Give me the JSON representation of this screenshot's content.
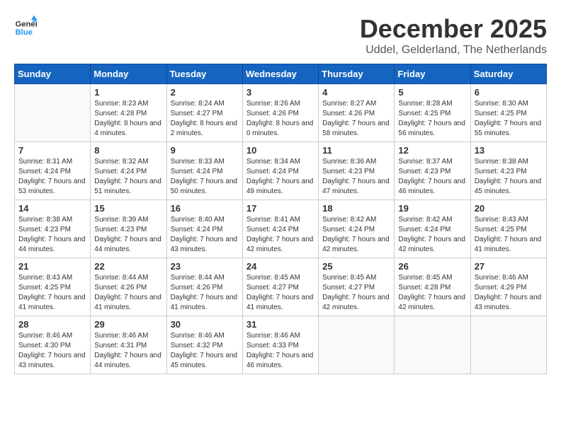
{
  "header": {
    "logo_line1": "General",
    "logo_line2": "Blue",
    "month": "December 2025",
    "location": "Uddel, Gelderland, The Netherlands"
  },
  "weekdays": [
    "Sunday",
    "Monday",
    "Tuesday",
    "Wednesday",
    "Thursday",
    "Friday",
    "Saturday"
  ],
  "weeks": [
    [
      {
        "day": "",
        "empty": true
      },
      {
        "day": "1",
        "sunrise": "8:23 AM",
        "sunset": "4:28 PM",
        "daylight": "8 hours and 4 minutes."
      },
      {
        "day": "2",
        "sunrise": "8:24 AM",
        "sunset": "4:27 PM",
        "daylight": "8 hours and 2 minutes."
      },
      {
        "day": "3",
        "sunrise": "8:26 AM",
        "sunset": "4:26 PM",
        "daylight": "8 hours and 0 minutes."
      },
      {
        "day": "4",
        "sunrise": "8:27 AM",
        "sunset": "4:26 PM",
        "daylight": "7 hours and 58 minutes."
      },
      {
        "day": "5",
        "sunrise": "8:28 AM",
        "sunset": "4:25 PM",
        "daylight": "7 hours and 56 minutes."
      },
      {
        "day": "6",
        "sunrise": "8:30 AM",
        "sunset": "4:25 PM",
        "daylight": "7 hours and 55 minutes."
      }
    ],
    [
      {
        "day": "7",
        "sunrise": "8:31 AM",
        "sunset": "4:24 PM",
        "daylight": "7 hours and 53 minutes."
      },
      {
        "day": "8",
        "sunrise": "8:32 AM",
        "sunset": "4:24 PM",
        "daylight": "7 hours and 51 minutes."
      },
      {
        "day": "9",
        "sunrise": "8:33 AM",
        "sunset": "4:24 PM",
        "daylight": "7 hours and 50 minutes."
      },
      {
        "day": "10",
        "sunrise": "8:34 AM",
        "sunset": "4:24 PM",
        "daylight": "7 hours and 49 minutes."
      },
      {
        "day": "11",
        "sunrise": "8:36 AM",
        "sunset": "4:23 PM",
        "daylight": "7 hours and 47 minutes."
      },
      {
        "day": "12",
        "sunrise": "8:37 AM",
        "sunset": "4:23 PM",
        "daylight": "7 hours and 46 minutes."
      },
      {
        "day": "13",
        "sunrise": "8:38 AM",
        "sunset": "4:23 PM",
        "daylight": "7 hours and 45 minutes."
      }
    ],
    [
      {
        "day": "14",
        "sunrise": "8:38 AM",
        "sunset": "4:23 PM",
        "daylight": "7 hours and 44 minutes."
      },
      {
        "day": "15",
        "sunrise": "8:39 AM",
        "sunset": "4:23 PM",
        "daylight": "7 hours and 44 minutes."
      },
      {
        "day": "16",
        "sunrise": "8:40 AM",
        "sunset": "4:24 PM",
        "daylight": "7 hours and 43 minutes."
      },
      {
        "day": "17",
        "sunrise": "8:41 AM",
        "sunset": "4:24 PM",
        "daylight": "7 hours and 42 minutes."
      },
      {
        "day": "18",
        "sunrise": "8:42 AM",
        "sunset": "4:24 PM",
        "daylight": "7 hours and 42 minutes."
      },
      {
        "day": "19",
        "sunrise": "8:42 AM",
        "sunset": "4:24 PM",
        "daylight": "7 hours and 42 minutes."
      },
      {
        "day": "20",
        "sunrise": "8:43 AM",
        "sunset": "4:25 PM",
        "daylight": "7 hours and 41 minutes."
      }
    ],
    [
      {
        "day": "21",
        "sunrise": "8:43 AM",
        "sunset": "4:25 PM",
        "daylight": "7 hours and 41 minutes."
      },
      {
        "day": "22",
        "sunrise": "8:44 AM",
        "sunset": "4:26 PM",
        "daylight": "7 hours and 41 minutes."
      },
      {
        "day": "23",
        "sunrise": "8:44 AM",
        "sunset": "4:26 PM",
        "daylight": "7 hours and 41 minutes."
      },
      {
        "day": "24",
        "sunrise": "8:45 AM",
        "sunset": "4:27 PM",
        "daylight": "7 hours and 41 minutes."
      },
      {
        "day": "25",
        "sunrise": "8:45 AM",
        "sunset": "4:27 PM",
        "daylight": "7 hours and 42 minutes."
      },
      {
        "day": "26",
        "sunrise": "8:45 AM",
        "sunset": "4:28 PM",
        "daylight": "7 hours and 42 minutes."
      },
      {
        "day": "27",
        "sunrise": "8:46 AM",
        "sunset": "4:29 PM",
        "daylight": "7 hours and 43 minutes."
      }
    ],
    [
      {
        "day": "28",
        "sunrise": "8:46 AM",
        "sunset": "4:30 PM",
        "daylight": "7 hours and 43 minutes."
      },
      {
        "day": "29",
        "sunrise": "8:46 AM",
        "sunset": "4:31 PM",
        "daylight": "7 hours and 44 minutes."
      },
      {
        "day": "30",
        "sunrise": "8:46 AM",
        "sunset": "4:32 PM",
        "daylight": "7 hours and 45 minutes."
      },
      {
        "day": "31",
        "sunrise": "8:46 AM",
        "sunset": "4:33 PM",
        "daylight": "7 hours and 46 minutes."
      },
      {
        "day": "",
        "empty": true
      },
      {
        "day": "",
        "empty": true
      },
      {
        "day": "",
        "empty": true
      }
    ]
  ]
}
